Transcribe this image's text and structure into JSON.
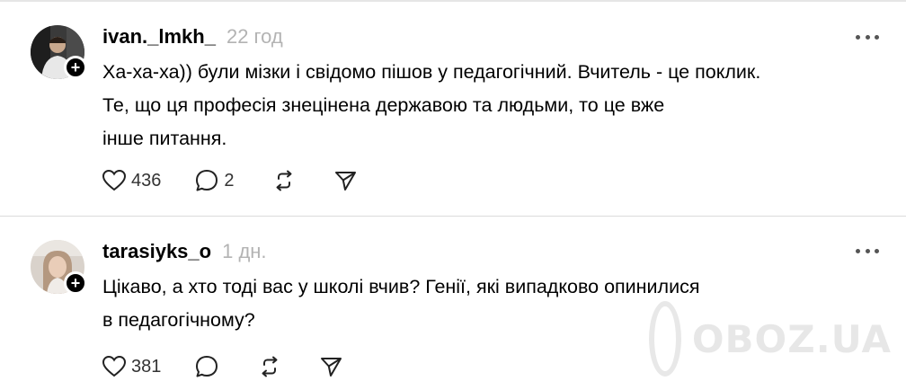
{
  "posts": [
    {
      "username": "ivan._lmkh_",
      "time": "22 год",
      "text_lines": [
        "Ха-ха-ха)) були мізки і свідомо пішов у педагогічний. Вчитель - це поклик.",
        "Те, що ця професія знецінена державою та людьми, то це вже",
        "інше питання."
      ],
      "likes": "436",
      "replies": "2",
      "follow_badge": "+"
    },
    {
      "username": "tarasiyks_o",
      "time": "1 дн.",
      "text_lines": [
        "Цікаво, а хто тоді вас у школі вчив? Генії, які випадково опинилися",
        "в педагогічному?"
      ],
      "likes": "381",
      "replies": "",
      "follow_badge": "+"
    }
  ],
  "icons": {
    "like": "heart-icon",
    "reply": "speech-bubble-icon",
    "repost": "repost-icon",
    "share": "send-icon",
    "more": "more-dots-icon"
  },
  "watermark": "OBOZ.UA",
  "colors": {
    "text": "#000000",
    "muted": "#b3b3b3",
    "divider": "#dcdcdc"
  }
}
